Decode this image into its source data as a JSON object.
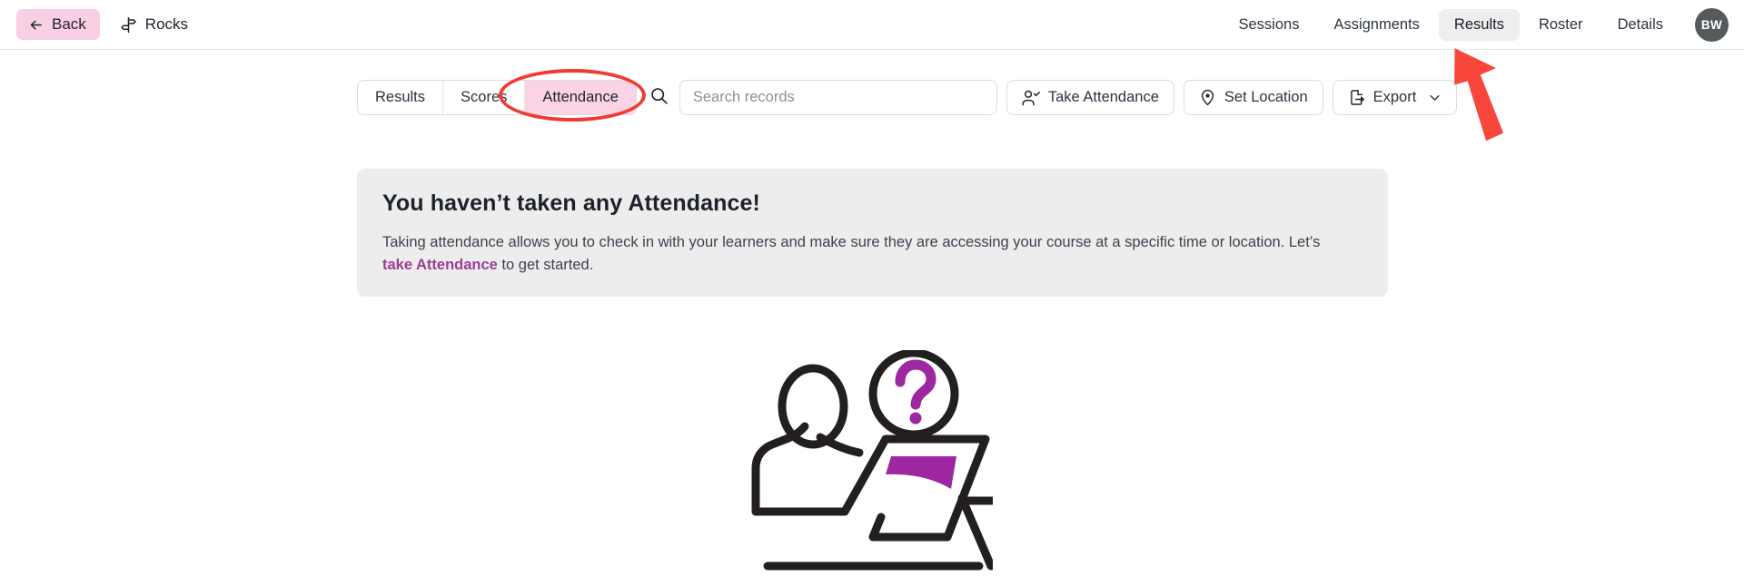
{
  "header": {
    "back_label": "Back",
    "back_icon": "arrow-left-icon",
    "course_name": "Rocks",
    "course_icon": "signpost-icon",
    "nav_items": [
      {
        "label": "Sessions",
        "active": false
      },
      {
        "label": "Assignments",
        "active": false
      },
      {
        "label": "Results",
        "active": true
      },
      {
        "label": "Roster",
        "active": false
      },
      {
        "label": "Details",
        "active": false
      }
    ],
    "avatar_initials": "BW"
  },
  "toolbar": {
    "segments": [
      {
        "label": "Results",
        "active": false
      },
      {
        "label": "Scores",
        "active": false
      },
      {
        "label": "Attendance",
        "active": true
      }
    ],
    "search": {
      "icon": "search-icon",
      "placeholder": "Search records",
      "value": ""
    },
    "buttons": [
      {
        "label": "Take Attendance",
        "icon": "user-check-icon"
      },
      {
        "label": "Set Location",
        "icon": "map-pin-icon"
      },
      {
        "label": "Export",
        "icon": "file-export-icon",
        "chevron": "chevron-down-icon"
      }
    ]
  },
  "info_panel": {
    "title": "You haven’t taken any Attendance!",
    "body_before_link": "Taking attendance allows you to check in with your learners and make sure they are accessing your course at a specific time or location. Let’s ",
    "link_text": "take Attendance",
    "body_after_link": " to get started."
  },
  "illustration": {
    "name": "person-at-desk-with-question-mark-illustration",
    "accent_color": "#9c27a0",
    "line_color": "#231f20"
  },
  "annotations": {
    "ellipse": {
      "name": "attendance-tab-highlight",
      "color": "#ef3b32",
      "targets": "Attendance"
    },
    "arrow": {
      "name": "results-nav-pointer",
      "color": "#f8463c",
      "targets": "Results"
    }
  },
  "colors": {
    "accent_pink": "#fad3e4",
    "link_purple": "#9b3d94",
    "panel_gray": "#ededed",
    "annotation_red": "#ef3b32",
    "avatar_gray": "#555b5c"
  }
}
